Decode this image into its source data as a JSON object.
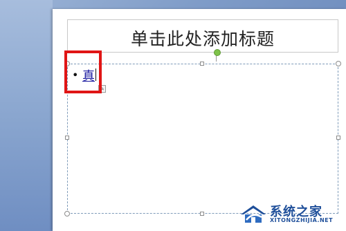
{
  "slide": {
    "title_placeholder": "单击此处添加标题",
    "content": {
      "bullet": "•",
      "text": "真"
    }
  },
  "watermark": {
    "title": "系统之家",
    "subtitle": "XITONGZHIJIA.NET"
  },
  "colors": {
    "annotation": "#e01515",
    "link_text": "#1a1aa0",
    "rotate_handle": "#7ec24a",
    "watermark": "#1f4f9a"
  }
}
